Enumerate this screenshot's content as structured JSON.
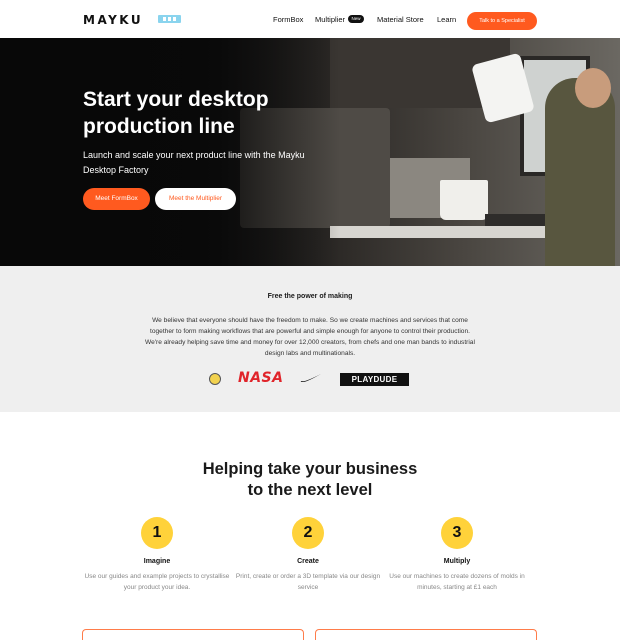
{
  "header": {
    "logo": "MAYKU",
    "nav": {
      "formbox": "FormBox",
      "multiplier": "Multiplier",
      "multiplier_badge": "New",
      "material_store": "Material Store",
      "learn": "Learn"
    },
    "cta": "Talk to a Specialist"
  },
  "hero": {
    "title": "Start your desktop production line",
    "subtitle": "Launch and scale your next product line with the Mayku Desktop Factory",
    "primary_button": "Meet FormBox",
    "secondary_button": "Meet the Multiplier"
  },
  "mission": {
    "title": "Free the power of making",
    "body": "We believe that everyone should have the freedom to make. So we create machines and services that come together to form making workflows that are powerful and simple enough for anyone to control their production. We're already helping save time and money for over 12,000 creators, from chefs and one man bands to industrial design labs and multinationals.",
    "logos": [
      "crest-logo",
      "NASA",
      "nike-swoosh",
      "PLAYDUDE"
    ]
  },
  "help": {
    "title_line1": "Helping take your business",
    "title_line2": "to the next level",
    "steps": [
      {
        "number": "1",
        "title": "Imagine",
        "desc": "Use our guides and example projects to crystallise your product your idea."
      },
      {
        "number": "2",
        "title": "Create",
        "desc": "Print, create or order a 3D template via our design service"
      },
      {
        "number": "3",
        "title": "Multiply",
        "desc": "Use our machines to create dozens of molds in minutes, starting at £1 each"
      }
    ]
  },
  "colors": {
    "accent": "#ff5a1f",
    "step_circle": "#ffd23a",
    "mission_bg": "#efefef"
  }
}
